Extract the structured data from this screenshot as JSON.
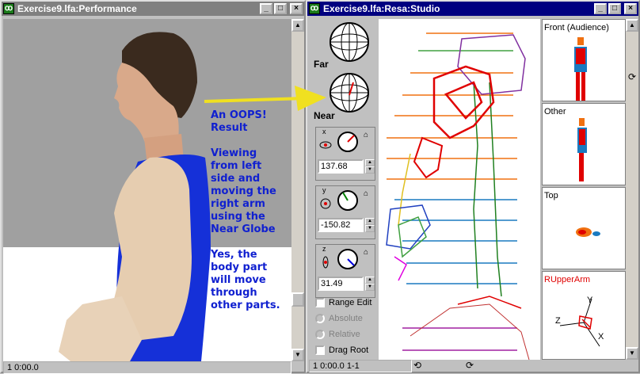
{
  "left_window": {
    "title": "Exercise9.lfa:Performance",
    "min": "_",
    "max": "□",
    "close": "×",
    "status": "1 0:00.0"
  },
  "right_window": {
    "title": "Exercise9.lfa:Resa:Studio",
    "min": "_",
    "max": "□",
    "close": "×",
    "status": "1 0:00.0 1-1"
  },
  "globes": {
    "far_label": "Far",
    "near_label": "Near"
  },
  "controls": {
    "x": {
      "axis": "x",
      "value": "137.68"
    },
    "y": {
      "axis": "y",
      "value": "-150.82"
    },
    "z": {
      "axis": "z",
      "value": "31.49"
    },
    "range_edit": "Range Edit",
    "absolute": "Absolute",
    "relative": "Relative",
    "drag_root": "Drag Root"
  },
  "views": {
    "front": "Front (Audience)",
    "other": "Other",
    "top": "Top",
    "selected_part": "RUpperArm",
    "axis_x": "X",
    "axis_y": "Y",
    "axis_z": "Z"
  },
  "annotation": {
    "line1": "An OOPS!",
    "line2": "Result",
    "line3": "Viewing",
    "line4": "from left",
    "line5": "side and",
    "line6": "moving the",
    "line7": "right arm",
    "line8": "using the",
    "line9": "Near Globe",
    "line10": "Yes, the",
    "line11": "body part",
    "line12": "will move",
    "line13": "through",
    "line14": "other parts."
  },
  "colors": {
    "active_title": "#000080",
    "inactive_title": "#808080",
    "annotation_text": "#1020d0",
    "arrow": "#f0e020",
    "selected_part_text": "#e00000"
  }
}
